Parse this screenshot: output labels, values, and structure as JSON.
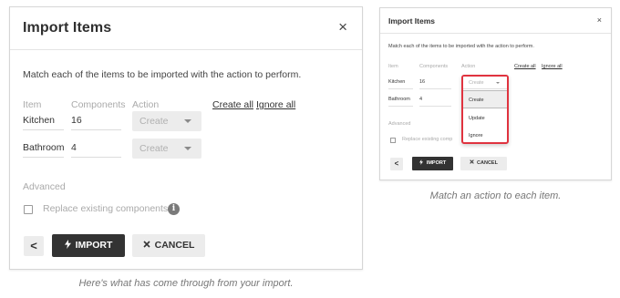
{
  "dialog": {
    "title": "Import Items",
    "close_glyph": "×",
    "description": "Match each of the items to be imported with the action to perform.",
    "columns": {
      "item": "Item",
      "components": "Components",
      "action": "Action"
    },
    "links": {
      "create_all": "Create all",
      "ignore_all": "Ignore all"
    },
    "rows": [
      {
        "item": "Kitchen",
        "components": "16",
        "action": "Create"
      },
      {
        "item": "Bathroom",
        "components": "4",
        "action": "Create"
      }
    ],
    "advanced_label": "Advanced",
    "checkbox_label": "Replace existing components",
    "checkbox_label_truncated": "Replace existing comp",
    "info_glyph": "i",
    "back_glyph": "<",
    "import_label": "IMPORT",
    "import_icon": "lightning-icon",
    "cancel_label": "CANCEL",
    "cancel_icon": "close-icon"
  },
  "dropdown": {
    "current": "Create",
    "options": [
      "Create",
      "Update",
      "Ignore"
    ],
    "highlighted": "Create",
    "accent_color": "#e0333f"
  },
  "captions": {
    "large": "Here's what has come through from your import.",
    "small": "Match an action to each item."
  }
}
